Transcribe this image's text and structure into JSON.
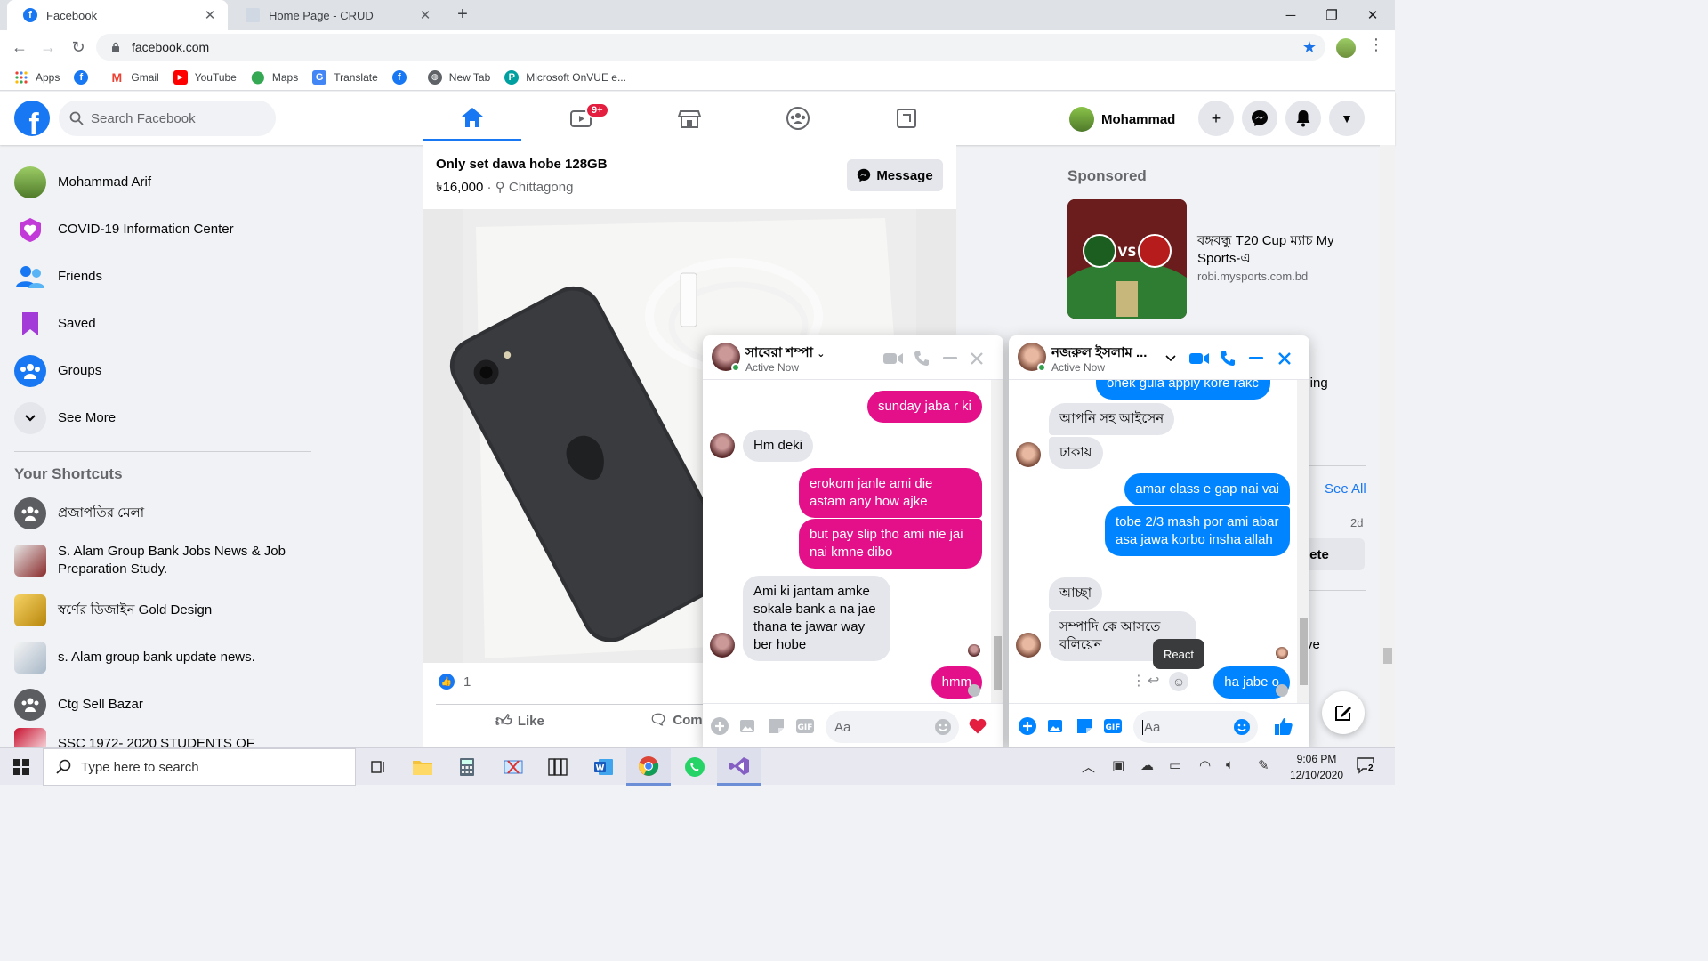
{
  "browser": {
    "tabs": [
      {
        "title": "Facebook",
        "active": true
      },
      {
        "title": "Home Page - CRUD",
        "active": false
      }
    ],
    "url": "facebook.com",
    "bookmarks": [
      "Apps",
      "Gmail",
      "YouTube",
      "Maps",
      "Translate",
      "New Tab",
      "Microsoft OnVUE e..."
    ]
  },
  "fb_header": {
    "search_placeholder": "Search Facebook",
    "watch_badge": "9+",
    "profile_name": "Mohammad",
    "brand_color": "#1877f2"
  },
  "left_nav": {
    "items": [
      {
        "label": "Mohammad Arif",
        "icon": "profile-avatar"
      },
      {
        "label": "COVID-19 Information Center",
        "icon": "covid-heart-icon"
      },
      {
        "label": "Friends",
        "icon": "friends-icon"
      },
      {
        "label": "Saved",
        "icon": "bookmark-icon"
      },
      {
        "label": "Groups",
        "icon": "groups-icon"
      },
      {
        "label": "See More",
        "icon": "chevron-down-icon"
      }
    ],
    "shortcuts_title": "Your Shortcuts",
    "shortcuts": [
      "প্রজাপতির মেলা",
      "S. Alam Group Bank Jobs News & Job Preparation Study.",
      "স্বর্ণের ডিজাইন Gold Design",
      "s. Alam group bank update news.",
      "Ctg Sell Bazar",
      "SSC 1972- 2020 STUDENTS OF"
    ]
  },
  "post": {
    "title": "Only set dawa hobe 128GB",
    "price": "৳16,000",
    "location": "Chittagong",
    "message_button": "Message",
    "like_count": "1",
    "like_label": "Like",
    "comment_label": "Comm"
  },
  "right_col": {
    "sponsored_title": "Sponsored",
    "ad_title": "বঙ্গবন্ধু T20 Cup ম্যাচ My Sports-এ",
    "ad_url": "robi.mysports.com.bd",
    "partial_text": "pping",
    "see_all": "See All",
    "age": "2d",
    "delete_partial": "lete",
    "partial_ve": "ve"
  },
  "chat1": {
    "name": "সাবেরা শম্পা",
    "status": "Active Now",
    "messages": [
      {
        "from": "me",
        "text": "sunday jaba r ki"
      },
      {
        "from": "them",
        "text": "Hm deki"
      },
      {
        "from": "me",
        "text": "erokom janle ami die astam any how ajke"
      },
      {
        "from": "me",
        "text": "but pay slip tho ami nie jai nai kmne dibo"
      },
      {
        "from": "them",
        "text": "Ami ki jantam amke sokale bank a na jae thana te jawar way ber hobe"
      },
      {
        "from": "me",
        "text": "hmm"
      }
    ],
    "input_placeholder": "Aa",
    "accent": "#e3108a"
  },
  "chat2": {
    "name": "নজরুল ইসলাম ...",
    "status": "Active Now",
    "messages": [
      {
        "from": "me",
        "text": "onek gula apply kore rakc"
      },
      {
        "from": "them",
        "text": "আপনি সহ আইসেন"
      },
      {
        "from": "them",
        "text": "ঢাকায়"
      },
      {
        "from": "me",
        "text": "amar class e gap nai vai"
      },
      {
        "from": "me",
        "text": "tobe 2/3 mash por ami abar asa jawa korbo insha allah"
      },
      {
        "from": "them",
        "text": "আচ্ছা"
      },
      {
        "from": "them",
        "text": "সম্পাদি কে আসতে বলিয়েন"
      },
      {
        "from": "me",
        "text": "ha jabe o"
      }
    ],
    "tooltip": "React",
    "input_placeholder": "Aa",
    "accent": "#0084ff"
  },
  "taskbar": {
    "search_placeholder": "Type here to search",
    "time": "9:06 PM",
    "date": "12/10/2020",
    "notification_count": "2"
  }
}
